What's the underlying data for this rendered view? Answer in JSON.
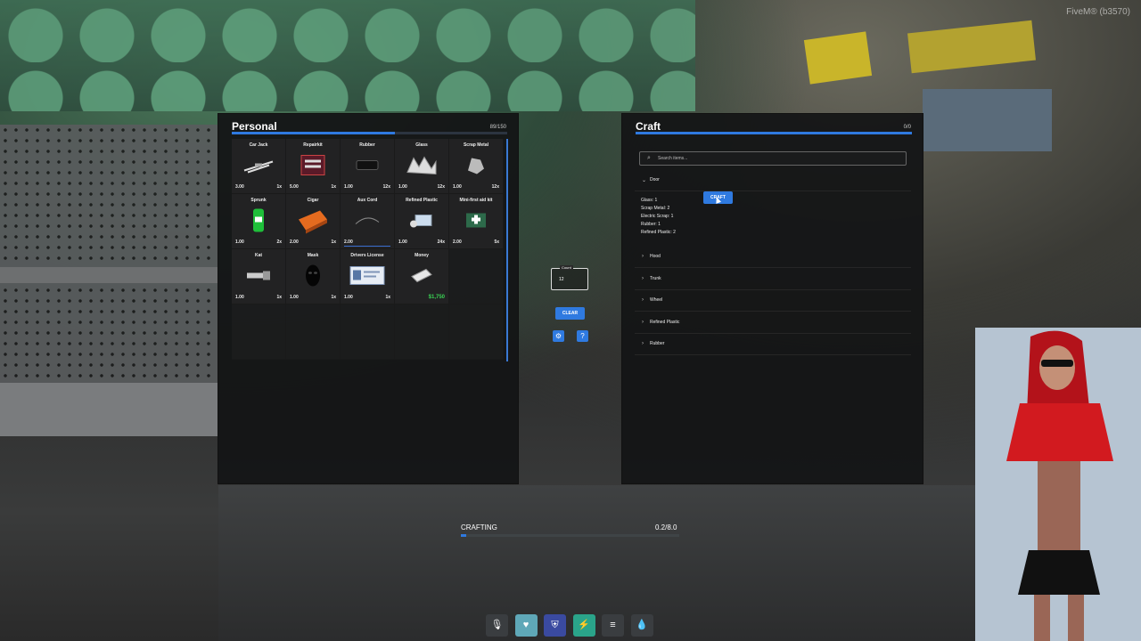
{
  "server": {
    "text": "FiveM® (b3570)"
  },
  "personal": {
    "title": "Personal",
    "weight": "89/150",
    "weight_fraction": 0.593,
    "items": [
      {
        "name": "Car Jack",
        "weight": "3.00",
        "count": "1x",
        "icon": "car-jack-icon"
      },
      {
        "name": "Repairkit",
        "weight": "5.00",
        "count": "1x",
        "icon": "repairkit-icon"
      },
      {
        "name": "Rubber",
        "weight": "1.00",
        "count": "12x",
        "icon": "rubber-icon"
      },
      {
        "name": "Glass",
        "weight": "1.00",
        "count": "12x",
        "icon": "glass-icon"
      },
      {
        "name": "Scrap Metal",
        "weight": "1.00",
        "count": "12x",
        "icon": "scrap-metal-icon"
      },
      {
        "name": "Sprunk",
        "weight": "1.00",
        "count": "2x",
        "icon": "sprunk-can-icon"
      },
      {
        "name": "Cigar",
        "weight": "2.00",
        "count": "1x",
        "icon": "cigar-box-icon"
      },
      {
        "name": "Aux Cord",
        "weight": "2.00",
        "count": "",
        "icon": "aux-cord-icon"
      },
      {
        "name": "Refined Plastic",
        "weight": "1.00",
        "count": "24x",
        "icon": "refined-plastic-icon"
      },
      {
        "name": "Mini-first aid kit",
        "weight": "2.00",
        "count": "5x",
        "icon": "first-aid-kit-icon"
      },
      {
        "name": "Kat",
        "weight": "1.00",
        "count": "1x",
        "icon": "kat-icon"
      },
      {
        "name": "Mask",
        "weight": "1.00",
        "count": "1x",
        "icon": "mask-icon"
      },
      {
        "name": "Drivers License",
        "weight": "1.00",
        "count": "1x",
        "icon": "license-card-icon"
      },
      {
        "name": "Money",
        "weight": "",
        "count": "$1,750",
        "icon": "money-icon",
        "money": true
      }
    ]
  },
  "controls": {
    "count_label": "Count",
    "count_value": "12",
    "clear_label": "CLEAR"
  },
  "craft": {
    "title": "Craft",
    "weight": "0/0",
    "search_placeholder": "Search items...",
    "craft_label": "CRAFT",
    "recipes": [
      {
        "name": "Door",
        "expanded": true,
        "requirements": [
          "Glass: 1",
          "Scrap Metal: 2",
          "Electric Scrap: 1",
          "Rubber: 1",
          "Refined Plastic: 2"
        ]
      },
      {
        "name": "Hood"
      },
      {
        "name": "Trunk"
      },
      {
        "name": "Wheel"
      },
      {
        "name": "Refined Plastic"
      },
      {
        "name": "Rubber"
      }
    ]
  },
  "crafting": {
    "label": "CRAFTING",
    "value": "0.2/8.0",
    "fraction": 0.025
  },
  "statusbar": [
    {
      "icon": "microphone-icon",
      "color": "#3a3d40"
    },
    {
      "icon": "heart-icon",
      "color": "#5fa8b8"
    },
    {
      "icon": "shield-icon",
      "color": "#3a4aa0"
    },
    {
      "icon": "lightning-icon",
      "color": "#2aa48a"
    },
    {
      "icon": "burger-icon",
      "color": "#3a3d40"
    },
    {
      "icon": "water-drop-icon",
      "color": "#3a3d40"
    }
  ],
  "colors": {
    "accent": "#2f7ae0",
    "money": "#39d153"
  }
}
